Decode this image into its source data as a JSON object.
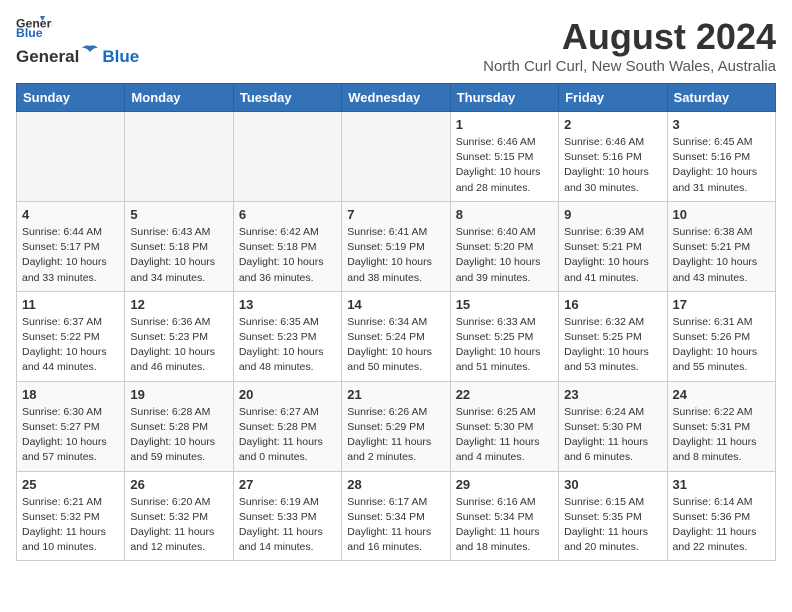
{
  "header": {
    "logo_line1": "General",
    "logo_line2": "Blue",
    "month_title": "August 2024",
    "location": "North Curl Curl, New South Wales, Australia"
  },
  "weekdays": [
    "Sunday",
    "Monday",
    "Tuesday",
    "Wednesday",
    "Thursday",
    "Friday",
    "Saturday"
  ],
  "weeks": [
    [
      {
        "day": "",
        "info": ""
      },
      {
        "day": "",
        "info": ""
      },
      {
        "day": "",
        "info": ""
      },
      {
        "day": "",
        "info": ""
      },
      {
        "day": "1",
        "info": "Sunrise: 6:46 AM\nSunset: 5:15 PM\nDaylight: 10 hours\nand 28 minutes."
      },
      {
        "day": "2",
        "info": "Sunrise: 6:46 AM\nSunset: 5:16 PM\nDaylight: 10 hours\nand 30 minutes."
      },
      {
        "day": "3",
        "info": "Sunrise: 6:45 AM\nSunset: 5:16 PM\nDaylight: 10 hours\nand 31 minutes."
      }
    ],
    [
      {
        "day": "4",
        "info": "Sunrise: 6:44 AM\nSunset: 5:17 PM\nDaylight: 10 hours\nand 33 minutes."
      },
      {
        "day": "5",
        "info": "Sunrise: 6:43 AM\nSunset: 5:18 PM\nDaylight: 10 hours\nand 34 minutes."
      },
      {
        "day": "6",
        "info": "Sunrise: 6:42 AM\nSunset: 5:18 PM\nDaylight: 10 hours\nand 36 minutes."
      },
      {
        "day": "7",
        "info": "Sunrise: 6:41 AM\nSunset: 5:19 PM\nDaylight: 10 hours\nand 38 minutes."
      },
      {
        "day": "8",
        "info": "Sunrise: 6:40 AM\nSunset: 5:20 PM\nDaylight: 10 hours\nand 39 minutes."
      },
      {
        "day": "9",
        "info": "Sunrise: 6:39 AM\nSunset: 5:21 PM\nDaylight: 10 hours\nand 41 minutes."
      },
      {
        "day": "10",
        "info": "Sunrise: 6:38 AM\nSunset: 5:21 PM\nDaylight: 10 hours\nand 43 minutes."
      }
    ],
    [
      {
        "day": "11",
        "info": "Sunrise: 6:37 AM\nSunset: 5:22 PM\nDaylight: 10 hours\nand 44 minutes."
      },
      {
        "day": "12",
        "info": "Sunrise: 6:36 AM\nSunset: 5:23 PM\nDaylight: 10 hours\nand 46 minutes."
      },
      {
        "day": "13",
        "info": "Sunrise: 6:35 AM\nSunset: 5:23 PM\nDaylight: 10 hours\nand 48 minutes."
      },
      {
        "day": "14",
        "info": "Sunrise: 6:34 AM\nSunset: 5:24 PM\nDaylight: 10 hours\nand 50 minutes."
      },
      {
        "day": "15",
        "info": "Sunrise: 6:33 AM\nSunset: 5:25 PM\nDaylight: 10 hours\nand 51 minutes."
      },
      {
        "day": "16",
        "info": "Sunrise: 6:32 AM\nSunset: 5:25 PM\nDaylight: 10 hours\nand 53 minutes."
      },
      {
        "day": "17",
        "info": "Sunrise: 6:31 AM\nSunset: 5:26 PM\nDaylight: 10 hours\nand 55 minutes."
      }
    ],
    [
      {
        "day": "18",
        "info": "Sunrise: 6:30 AM\nSunset: 5:27 PM\nDaylight: 10 hours\nand 57 minutes."
      },
      {
        "day": "19",
        "info": "Sunrise: 6:28 AM\nSunset: 5:28 PM\nDaylight: 10 hours\nand 59 minutes."
      },
      {
        "day": "20",
        "info": "Sunrise: 6:27 AM\nSunset: 5:28 PM\nDaylight: 11 hours\nand 0 minutes."
      },
      {
        "day": "21",
        "info": "Sunrise: 6:26 AM\nSunset: 5:29 PM\nDaylight: 11 hours\nand 2 minutes."
      },
      {
        "day": "22",
        "info": "Sunrise: 6:25 AM\nSunset: 5:30 PM\nDaylight: 11 hours\nand 4 minutes."
      },
      {
        "day": "23",
        "info": "Sunrise: 6:24 AM\nSunset: 5:30 PM\nDaylight: 11 hours\nand 6 minutes."
      },
      {
        "day": "24",
        "info": "Sunrise: 6:22 AM\nSunset: 5:31 PM\nDaylight: 11 hours\nand 8 minutes."
      }
    ],
    [
      {
        "day": "25",
        "info": "Sunrise: 6:21 AM\nSunset: 5:32 PM\nDaylight: 11 hours\nand 10 minutes."
      },
      {
        "day": "26",
        "info": "Sunrise: 6:20 AM\nSunset: 5:32 PM\nDaylight: 11 hours\nand 12 minutes."
      },
      {
        "day": "27",
        "info": "Sunrise: 6:19 AM\nSunset: 5:33 PM\nDaylight: 11 hours\nand 14 minutes."
      },
      {
        "day": "28",
        "info": "Sunrise: 6:17 AM\nSunset: 5:34 PM\nDaylight: 11 hours\nand 16 minutes."
      },
      {
        "day": "29",
        "info": "Sunrise: 6:16 AM\nSunset: 5:34 PM\nDaylight: 11 hours\nand 18 minutes."
      },
      {
        "day": "30",
        "info": "Sunrise: 6:15 AM\nSunset: 5:35 PM\nDaylight: 11 hours\nand 20 minutes."
      },
      {
        "day": "31",
        "info": "Sunrise: 6:14 AM\nSunset: 5:36 PM\nDaylight: 11 hours\nand 22 minutes."
      }
    ]
  ]
}
